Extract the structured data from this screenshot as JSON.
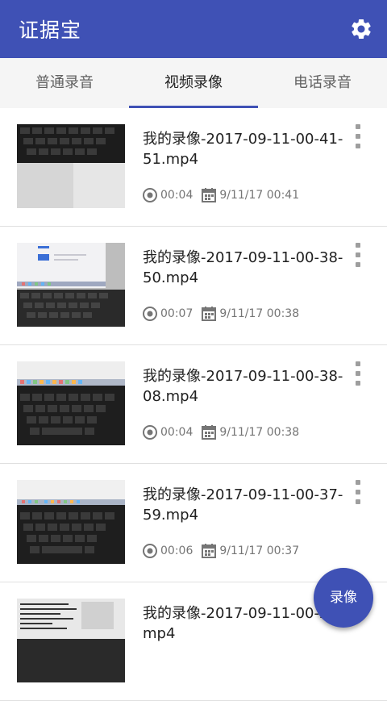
{
  "app": {
    "title": "证据宝"
  },
  "tabs": [
    {
      "label": "普通录音",
      "active": false
    },
    {
      "label": "视频录像",
      "active": true
    },
    {
      "label": "电话录音",
      "active": false
    }
  ],
  "recordings": [
    {
      "name": "我的录像-2017-09-11-00-41-51.mp4",
      "duration": "00:04",
      "date": "9/11/17 00:41",
      "thumb": "keyboard-paper"
    },
    {
      "name": "我的录像-2017-09-11-00-38-50.mp4",
      "duration": "00:07",
      "date": "9/11/17 00:38",
      "thumb": "laptop-screen"
    },
    {
      "name": "我的录像-2017-09-11-00-38-08.mp4",
      "duration": "00:04",
      "date": "9/11/17 00:38",
      "thumb": "laptop-dock"
    },
    {
      "name": "我的录像-2017-09-11-00-37-59.mp4",
      "duration": "00:06",
      "date": "9/11/17 00:37",
      "thumb": "laptop-dock"
    },
    {
      "name": "我的录像-2017-09-11-00-28.mp4",
      "duration": "",
      "date": "",
      "thumb": "laptop-text"
    }
  ],
  "fab": {
    "label": "录像"
  },
  "icons": {
    "settings": "gear-icon",
    "duration": "record-circle-icon",
    "date": "calendar-icon",
    "more": "more-vert-icon"
  },
  "colors": {
    "primary": "#3f51b5",
    "meta_text": "#757575"
  }
}
